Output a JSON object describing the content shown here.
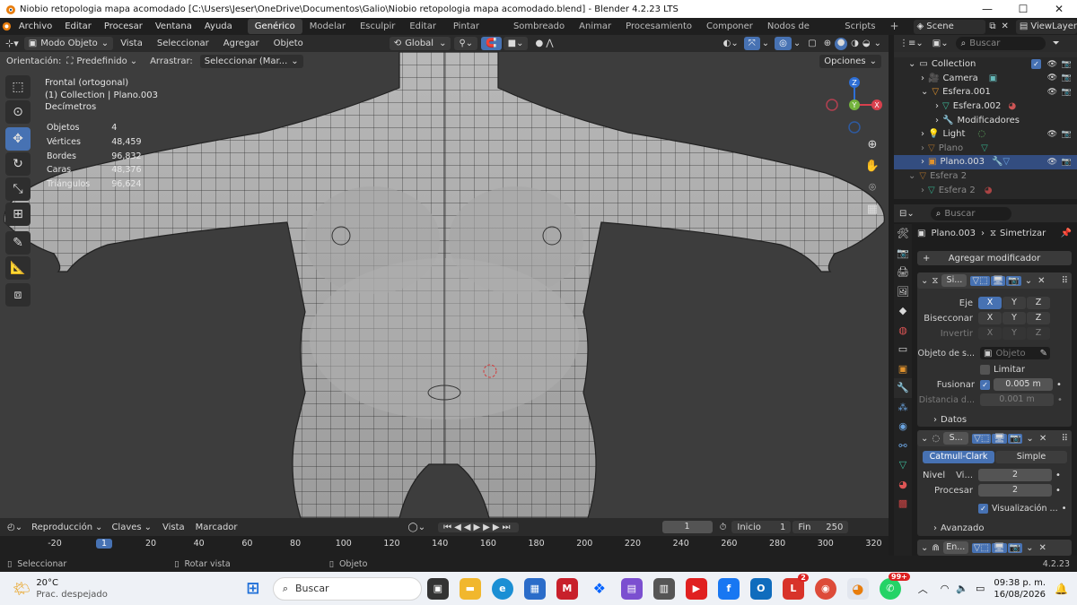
{
  "titlebar": {
    "title": "Niobio retopologia mapa acomodado [C:\\Users\\Jeser\\OneDrive\\Documentos\\Galio\\Niobio retopologia mapa acomodado.blend] - Blender 4.2.23 LTS"
  },
  "menubar": {
    "menus": [
      "Archivo",
      "Editar",
      "Procesar",
      "Ventana",
      "Ayuda"
    ],
    "workspaces": [
      "Genérico",
      "Modelar",
      "Esculpir",
      "Editar UV",
      "Pintar texturas",
      "Sombreado",
      "Animar",
      "Procesamiento",
      "Componer",
      "Nodos de geometría",
      "Scripts"
    ],
    "add": "+",
    "scene": "Scene",
    "view_layer": "ViewLayer"
  },
  "vp_header": {
    "mode": "Modo Objeto",
    "menus": [
      "Vista",
      "Seleccionar",
      "Agregar",
      "Objeto"
    ],
    "transform": "Global",
    "orientation_label": "Orientación:",
    "orientation_value": "Predefinido",
    "drag_label": "Arrastrar:",
    "drag_value": "Seleccionar (Mar...",
    "options": "Opciones"
  },
  "viewport": {
    "view_name": "Frontal (ortogonal)",
    "collection_line": "(1) Collection | Plano.003",
    "units": "Decímetros",
    "stats": [
      {
        "label": "Objetos",
        "value": "4"
      },
      {
        "label": "Vértices",
        "value": "48,459"
      },
      {
        "label": "Bordes",
        "value": "96,832"
      },
      {
        "label": "Caras",
        "value": "48,376"
      },
      {
        "label": "Triángulos",
        "value": "96,624"
      }
    ],
    "gizmo": {
      "x": "X",
      "y": "Y",
      "z": "Z"
    }
  },
  "outliner": {
    "search_placeholder": "Buscar",
    "rows": [
      {
        "label": "Collection",
        "indent": 1
      },
      {
        "label": "Camera",
        "indent": 2
      },
      {
        "label": "Esfera.001",
        "indent": 2
      },
      {
        "label": "Esfera.002",
        "indent": 3
      },
      {
        "label": "Modificadores",
        "indent": 3
      },
      {
        "label": "Light",
        "indent": 2
      },
      {
        "label": "Plano",
        "indent": 2
      },
      {
        "label": "Plano.003",
        "indent": 2
      },
      {
        "label": "Esfera 2",
        "indent": 1
      },
      {
        "label": "Esfera 2",
        "indent": 2
      }
    ]
  },
  "properties": {
    "search_placeholder": "Buscar",
    "object_name": "Plano.003",
    "modifier_crumb": "Simetrizar",
    "add_modifier": "Agregar modificador",
    "mirror": {
      "name": "Si...",
      "axis_label": "Eje",
      "bisect_label": "Bisecconar",
      "invert_label": "Invertir",
      "axes": [
        "X",
        "Y",
        "Z"
      ],
      "mirror_object_label": "Objeto de s...",
      "mirror_object_placeholder": "Objeto",
      "clip_label": "Limitar",
      "merge_label": "Fusionar",
      "merge_value": "0.005 m",
      "distance_label": "Distancia d...",
      "distance_value": "0.001 m",
      "data_label": "Datos"
    },
    "subsurf": {
      "name": "S...",
      "mode_a": "Catmull-Clark",
      "mode_b": "Simple",
      "level_label": "Nivel",
      "viewport_label": "Vi...",
      "viewport_value": "2",
      "render_label": "Procesar",
      "render_value": "2",
      "optimal_label": "Visualización ...",
      "advanced_label": "Avanzado"
    },
    "third": {
      "name": "En..."
    }
  },
  "timeline": {
    "menus": [
      "Reproducción",
      "Claves",
      "Vista",
      "Marcador"
    ],
    "current_frame": "1",
    "start_label": "Inicio",
    "start_value": "1",
    "end_label": "Fin",
    "end_value": "250",
    "ruler": [
      "-20",
      "1",
      "20",
      "40",
      "60",
      "80",
      "100",
      "120",
      "140",
      "160",
      "180",
      "200",
      "220",
      "240",
      "260",
      "280",
      "300",
      "320"
    ]
  },
  "statusbar": {
    "select": "Seleccionar",
    "rotate": "Rotar vista",
    "object": "Objeto",
    "version": "4.2.23"
  },
  "taskbar": {
    "weather_temp": "20°C",
    "weather_desc": "Prac. despejado",
    "search": "Buscar",
    "badge_l": "2",
    "badge_wa": "99+",
    "time": "09:38 p. m.",
    "date": "16/08/2026"
  }
}
